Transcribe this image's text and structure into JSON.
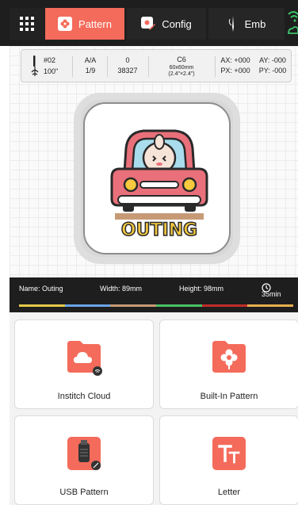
{
  "tabs": {
    "pattern": "Pattern",
    "config": "Config",
    "emb": "Emb"
  },
  "info": {
    "needle": "#02",
    "ratio_top": "A/A",
    "zero": "0",
    "hoop_code": "C6",
    "hoop_size": "60x60mm",
    "hoop_inches": "(2.4\"×2.4\")",
    "ax": "AX: +000",
    "ay": "AY: -000",
    "speed": "100\"",
    "ratio_bottom": "1/9",
    "stitches": "38327",
    "px": "PX: +000",
    "py": "PY: -000"
  },
  "design": {
    "word": "OUTING",
    "name": "Name: Outing",
    "width": "Width: 89mm",
    "height": "Height: 98mm",
    "time": "35min"
  },
  "thread_colors": [
    "#e6c84a",
    "#6aa5e6",
    "#c79a76",
    "#47c267",
    "#c22b2b",
    "#e7b04e"
  ],
  "cards": {
    "cloud": "Institch Cloud",
    "builtin": "Built-In Pattern",
    "usb": "USB Pattern",
    "letter": "Letter"
  },
  "colors": {
    "accent": "#f46b5b",
    "topbar": "#1e1e1e",
    "wifi": "#3cc36a"
  }
}
